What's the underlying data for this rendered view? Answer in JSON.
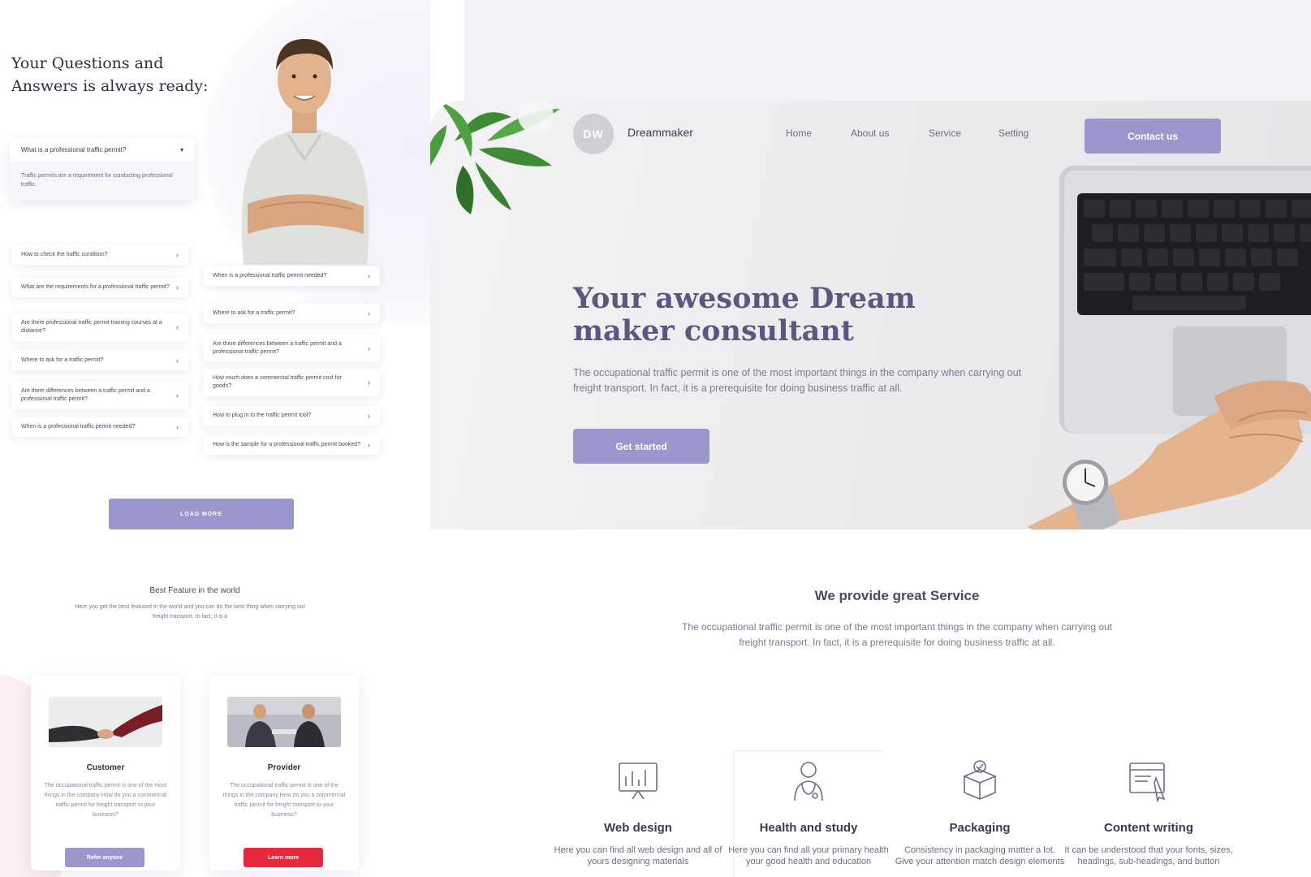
{
  "faq": {
    "title": "Your Questions and Answers is always ready:",
    "open_item": {
      "question": "What is a professional traffic permit?",
      "answer": "Traffic permits are a requirement for conducting professional traffic."
    },
    "left_items": [
      "How to check the traffic condition?",
      "What are the requirements for a professional traffic permit?",
      "Are there professional traffic permit training courses at a distance?",
      "Where to ask for a traffic permit?",
      "Are there differences between a traffic permit and a professional traffic permit?",
      "When is a professional traffic permit needed?"
    ],
    "right_items": [
      "When is a professional traffic permit needed?",
      "Where to ask for a traffic permit?",
      "Are there differences between a traffic permit and a professional traffic permit?",
      "How much does a commercial traffic permit cost for goods?",
      "How to plug in to the traffic permit tool?",
      "How is the sample for a professional traffic permit booked?"
    ],
    "load_more": "LOAD MORE"
  },
  "features": {
    "title": "Best Feature in the world",
    "text": "Here you get the best featured in the world and you can do the best thing when carrying out freight transport. In fact, it is a"
  },
  "cards": [
    {
      "title": "Customer",
      "text": "The occupational traffic permit is one of the most things in the company How do you a commercial traffic permit for freight transport to your business?",
      "button": "Refer anyone",
      "button_color": "#9a97cc"
    },
    {
      "title": "Provider",
      "text": "The occupational traffic permit is one of the things in the company How do you a commercial traffic permit for freight transport to your business?",
      "button": "Learn more",
      "button_color": "#e8283c"
    }
  ],
  "landing": {
    "logo": "DW",
    "brand": "Dreammaker",
    "nav": [
      "Home",
      "About us",
      "Service",
      "Setting"
    ],
    "contact": "Contact us",
    "hero_title": "Your awesome Dream maker consultant",
    "hero_desc": "The occupational traffic permit is one of the most important things in the company when carrying out freight transport. In fact, it is a prerequisite for doing business traffic at all.",
    "cta": "Get started",
    "services_title": "We provide great Service",
    "services_desc": "The occupational traffic permit is one of the most important things in the company when carrying out freight transport. In fact, it is a prerequisite for doing business traffic at all.",
    "services": [
      {
        "icon": "chart-board-icon",
        "title": "Web design",
        "text": "Here you can find all web design and all of yours designing materials"
      },
      {
        "icon": "doctor-icon",
        "title": "Health and study",
        "text": "Here you can find all your primary health your good health and education"
      },
      {
        "icon": "package-box-icon",
        "title": "Packaging",
        "text": "Consistency in packaging matter a lot. Give your attention match design elements"
      },
      {
        "icon": "content-writing-icon",
        "title": "Content writing",
        "text": "It can be understood that your fonts, sizes, headings, sub-headings, and button"
      }
    ]
  },
  "colors": {
    "accent": "#9a97cc",
    "danger": "#e8283c",
    "text_dark": "#3b3b4f"
  }
}
